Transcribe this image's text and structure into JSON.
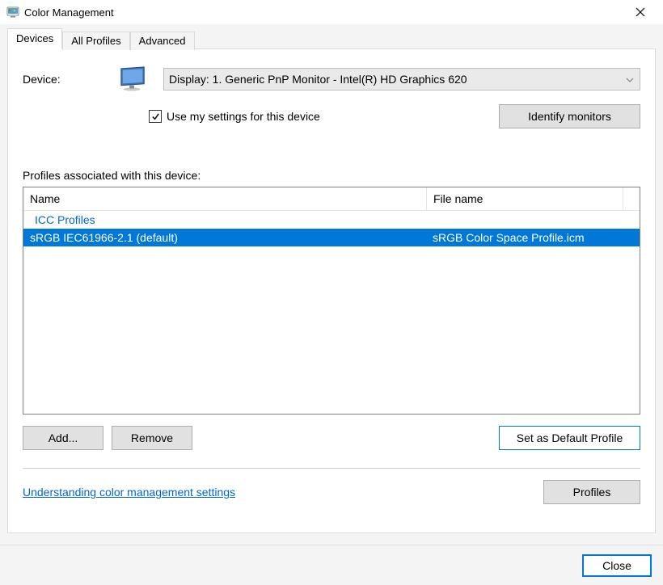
{
  "window": {
    "title": "Color Management"
  },
  "tabs": {
    "devices": "Devices",
    "all_profiles": "All Profiles",
    "advanced": "Advanced",
    "active": "devices"
  },
  "device": {
    "label": "Device:",
    "selected": "Display: 1. Generic PnP Monitor - Intel(R) HD Graphics 620",
    "use_my_settings_label": "Use my settings for this device",
    "use_my_settings_checked": true,
    "identify_button": "Identify monitors"
  },
  "profiles_section": {
    "label": "Profiles associated with this device:",
    "columns": {
      "name": "Name",
      "file": "File name"
    },
    "group_label": "ICC Profiles",
    "rows": [
      {
        "name": "sRGB IEC61966-2.1 (default)",
        "file": "sRGB Color Space Profile.icm",
        "selected": true
      }
    ]
  },
  "buttons": {
    "add": "Add...",
    "remove": "Remove",
    "set_default": "Set as Default Profile",
    "profiles": "Profiles",
    "close": "Close"
  },
  "help_link": "Understanding color management settings"
}
